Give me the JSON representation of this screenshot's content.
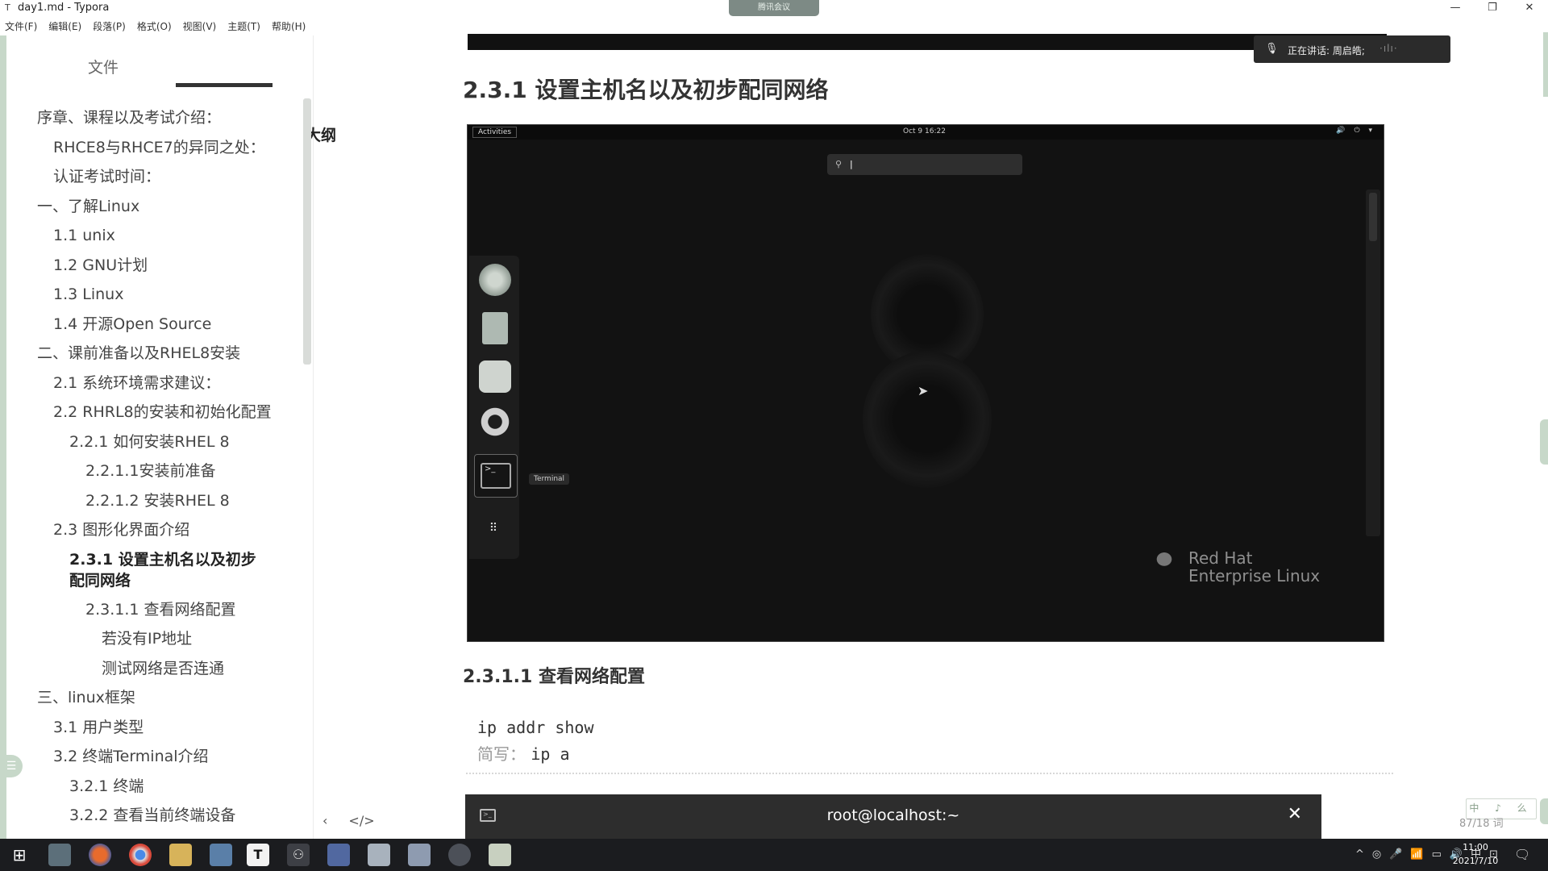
{
  "window": {
    "title": "day1.md - Typora",
    "app_icon": "T",
    "meeting_label": "腾讯会议",
    "controls": [
      "—",
      "❐",
      "✕"
    ]
  },
  "menu": [
    "文件(F)",
    "编辑(E)",
    "段落(P)",
    "格式(O)",
    "视图(V)",
    "主题(T)",
    "帮助(H)"
  ],
  "sidebar": {
    "tabs": {
      "file": "文件",
      "outline": "大纲"
    },
    "outline": [
      {
        "label": "序章、课程以及考试介绍：",
        "level": 1
      },
      {
        "label": "RHCE8与RHCE7的异同之处：",
        "level": 2
      },
      {
        "label": "认证考试时间：",
        "level": 2
      },
      {
        "label": "一、了解Linux",
        "level": 1
      },
      {
        "label": "1.1 unix",
        "level": 2
      },
      {
        "label": "1.2 GNU计划",
        "level": 2
      },
      {
        "label": "1.3 Linux",
        "level": 2
      },
      {
        "label": "1.4 开源Open Source",
        "level": 2
      },
      {
        "label": "二、课前准备以及RHEL8安装",
        "level": 1
      },
      {
        "label": "2.1 系统环境需求建议：",
        "level": 2
      },
      {
        "label": "2.2 RHRL8的安装和初始化配置",
        "level": 2
      },
      {
        "label": "2.2.1 如何安装RHEL 8",
        "level": 3
      },
      {
        "label": "2.2.1.1安装前准备",
        "level": 4
      },
      {
        "label": "2.2.1.2 安装RHEL 8",
        "level": 4
      },
      {
        "label": "2.3 图形化界面介绍",
        "level": 2
      },
      {
        "label": "2.3.1 设置主机名以及初步配同网络",
        "level": 3,
        "active": true
      },
      {
        "label": "2.3.1.1 查看网络配置",
        "level": 4
      },
      {
        "label": "若没有IP地址",
        "level": 5
      },
      {
        "label": "测试网络是否连通",
        "level": 5
      },
      {
        "label": "三、linux框架",
        "level": 1
      },
      {
        "label": "3.1 用户类型",
        "level": 2
      },
      {
        "label": "3.2 终端Terminal介绍",
        "level": 2
      },
      {
        "label": "3.2.1 终端",
        "level": 3
      },
      {
        "label": "3.2.2 查看当前终端设备",
        "level": 3
      }
    ],
    "footer": {
      "back": "‹",
      "source": "</>"
    }
  },
  "speaking": {
    "label": "正在讲话: 周启皓;",
    "wave": "·ılı·"
  },
  "content": {
    "heading": "2.3.1 设置主机名以及初步配同网络",
    "subheading": "2.3.1.1 查看网络配置",
    "code_lines": [
      {
        "prefix": "",
        "text": "ip addr show"
      },
      {
        "prefix": "简写：  ",
        "text": "ip a"
      }
    ]
  },
  "gnome": {
    "activities": "Activities",
    "clock": "Oct 9 16:22",
    "tray": "🔊 ⏻ ▾",
    "search_icon": "search-icon",
    "tooltip": "Terminal",
    "brand_line1": "Red Hat",
    "brand_line2": "Enterprise Linux",
    "dock": [
      "firefox-icon",
      "files-icon",
      "software-icon",
      "help-icon",
      "terminal-icon",
      "app-grid-icon"
    ]
  },
  "terminal": {
    "title": "root@localhost:~",
    "close": "✕"
  },
  "status": {
    "page_counter": "87/18 词",
    "ime": "中 ♪ 么"
  },
  "taskbar": {
    "apps": [
      "windows-start-icon",
      "image-viewer-icon",
      "firefox-icon",
      "chrome-icon",
      "file-explorer-icon",
      "photos-icon",
      "typora-icon",
      "network-icon",
      "virtualbox-icon",
      "keyboard-icon",
      "snip-icon",
      "meeting-icon",
      "notes-icon"
    ],
    "tray": [
      "^",
      "◎",
      "🎤",
      "📶",
      "▭",
      "🔊",
      "中",
      "⊡"
    ],
    "time": "11:00",
    "date": "2021/7/10"
  },
  "colors": {
    "accent_green": "#c7d8c9",
    "terminal_bg": "#2d2d2d",
    "taskbar_bg": "#1b1c1f"
  }
}
